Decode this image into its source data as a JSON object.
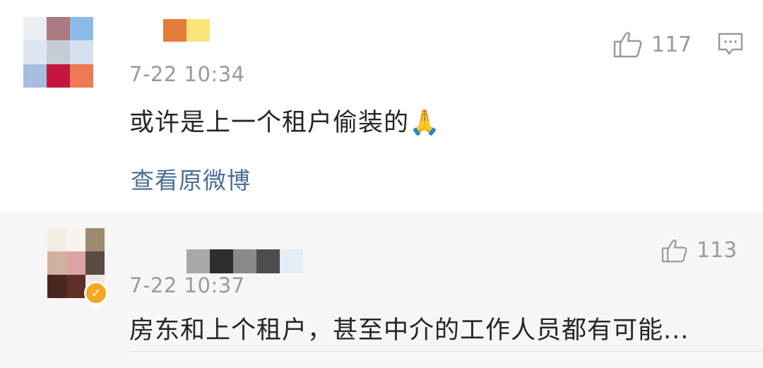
{
  "comments": [
    {
      "time": "7-22 10:34",
      "text": "或许是上一个租户偷装的🙏",
      "likes": "117",
      "link": "查看原微博",
      "avatar_colors": [
        "#ebeef3",
        "#a97a83",
        "#8bbce9",
        "#dfe6f2",
        "#c6ccd6",
        "#d5dfee",
        "#a6bce0",
        "#c2183f",
        "#ec7a52"
      ],
      "name_colors": [
        "#ffffff",
        "#e37d3a",
        "#fae57a"
      ]
    },
    {
      "time": "7-22 10:37",
      "text": "房东和上个租户，甚至中介的工作人员都有可能...",
      "likes": "113",
      "avatar_colors": [
        "#f3ece3",
        "#f7f4ee",
        "#9b8a6d",
        "#d0b2a1",
        "#dda3a2",
        "#5a4b44",
        "#4a2620",
        "#5e2f29",
        "#efe8e2"
      ],
      "name_colors": [
        "#a9a9a9",
        "#2e2e2e",
        "#8a8a8a",
        "#4d4d4d",
        "#e2eef7"
      ]
    }
  ],
  "icons": {
    "like": "thumbs-up-icon",
    "reply": "comment-icon",
    "verified": "verified-badge-icon",
    "emoji": "folded-hands-emoji"
  }
}
